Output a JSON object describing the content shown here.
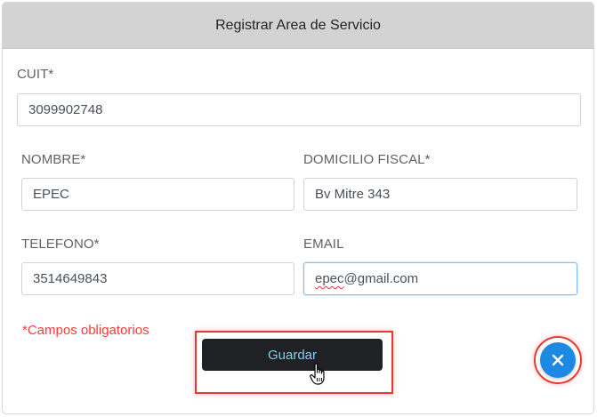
{
  "dialog": {
    "title": "Registrar Area de Servicio"
  },
  "form": {
    "cuit": {
      "label": "CUIT*",
      "value": "3099902748"
    },
    "nombre": {
      "label": "NOMBRE*",
      "value": "EPEC"
    },
    "domicilio": {
      "label": "DOMICILIO FISCAL*",
      "value": "Bv Mitre 343"
    },
    "telefono": {
      "label": "TELEFONO*",
      "value": "3514649843"
    },
    "email": {
      "label": "EMAIL",
      "value_prefix": "epec",
      "value_suffix": "@gmail.com"
    },
    "required_note": "*Campos obligatorios"
  },
  "actions": {
    "save_label": "Guardar",
    "close_icon": "close-icon"
  },
  "colors": {
    "header_bg": "#d3d3d3",
    "save_bg": "#1f2124",
    "save_text": "#7fd0f0",
    "close_bg": "#1e88e5",
    "highlight": "#e53935",
    "required": "#ff3b3b"
  }
}
